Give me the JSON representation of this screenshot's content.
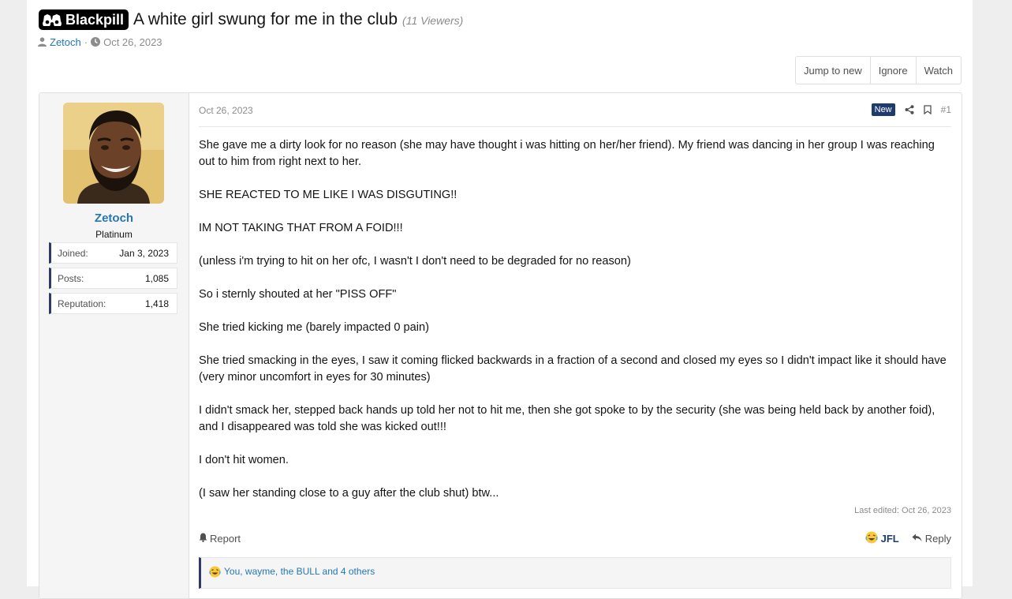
{
  "thread": {
    "prefix": "Blackpill",
    "title": "A white girl swung for me in the club",
    "viewers": "(11 Viewers)",
    "author": "Zetoch",
    "separator": "·",
    "date": "Oct 26, 2023"
  },
  "actions": {
    "jump_to_new": "Jump to new",
    "ignore": "Ignore",
    "watch": "Watch"
  },
  "user": {
    "name": "Zetoch",
    "title": "Platinum",
    "stats": [
      {
        "label": "Joined:",
        "value": "Jan 3, 2023"
      },
      {
        "label": "Posts:",
        "value": "1,085"
      },
      {
        "label": "Reputation:",
        "value": "1,418"
      }
    ]
  },
  "post": {
    "date": "Oct 26, 2023",
    "new_badge": "New",
    "number": "#1",
    "paragraphs": [
      "She gave me a dirty look for no reason (she may have thought i was hitting on her/her friend). My friend was dancing in her group I was reaching out to him from right next to her.",
      "SHE REACTED TO ME LIKE I WAS DISGUTING!!",
      "IM NOT TAKING THAT FROM A FOID!!!",
      "(unless i'm trying to hit on her ofc, I wasn't I don't need to be degraded for no reason)",
      "So i sternly shouted at her \"PISS OFF\"",
      "She tried kicking me (barely impacted 0 pain)",
      "She tried smacking in the eyes, I saw it coming flicked backwards in a fraction of a second and closed my eyes so I didn't impact like it should have (very minor uncomfort in eyes for 30 minutes)",
      "I didn't smack her, stepped back hands up told her not to hit me, then she got spoke to by the security (she was being held back by another foid), and I disappeared was told she was kicked out!!!",
      "I don't hit women.",
      "(I saw her standing close to a guy after the club shut) btw..."
    ],
    "last_edited": "Last edited: Oct 26, 2023",
    "report": "Report",
    "jfl": "JFL",
    "reply": "Reply",
    "reactions_text": "You, wayme, the BULL and 4 others"
  },
  "colors": {
    "link": "#2577b1",
    "accent": "#1f3b6e",
    "muted": "#8c8c8c"
  },
  "icons": [
    "user-icon",
    "clock-icon",
    "share-icon",
    "bookmark-icon",
    "bell-icon",
    "laugh-emoji-icon",
    "reply-icon",
    "binoculars-icon"
  ]
}
